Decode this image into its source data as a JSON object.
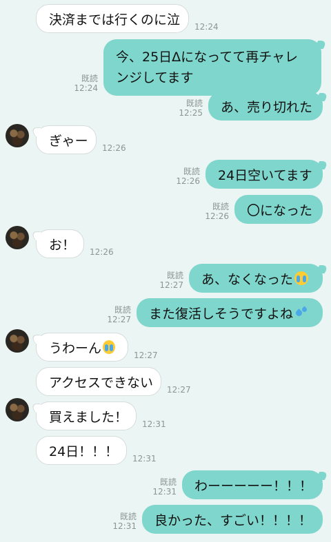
{
  "colors": {
    "background": "#ebf5f3",
    "outgoing_bubble": "#7fd6cc",
    "incoming_bubble": "#ffffff",
    "meta_text": "#8a9693"
  },
  "messages": [
    {
      "dir": "in",
      "text": "決済までは行くのに泣",
      "time": "12:24",
      "avatar": false
    },
    {
      "dir": "out",
      "text": "今、25日Δになってて再チャレンジしてます",
      "time": "12:24",
      "read": "既読"
    },
    {
      "dir": "out",
      "text": "あ、売り切れた",
      "time": "12:25",
      "read": "既読"
    },
    {
      "dir": "in",
      "text": "ぎゃー",
      "time": "12:26",
      "avatar": true
    },
    {
      "dir": "out",
      "text": "24日空いてます",
      "time": "12:26",
      "read": "既読"
    },
    {
      "dir": "out",
      "text": "〇になった",
      "time": "12:26",
      "read": "既読"
    },
    {
      "dir": "in",
      "text": "お！",
      "time": "12:26",
      "avatar": true
    },
    {
      "dir": "out",
      "text": "あ、なくなった",
      "emoji": "loudly-crying-face-icon",
      "time": "12:27",
      "read": "既読"
    },
    {
      "dir": "out",
      "text": "また復活しそうですよね",
      "emoji": "sweat-droplets-icon",
      "time": "12:27",
      "read": "既読"
    },
    {
      "dir": "in",
      "text": "うわーん",
      "emoji": "loudly-crying-face-icon",
      "time": "12:27",
      "avatar": true
    },
    {
      "dir": "in",
      "text": "アクセスできない",
      "time": "12:27",
      "avatar": false
    },
    {
      "dir": "in",
      "text": "買えました！",
      "time": "12:31",
      "avatar": true
    },
    {
      "dir": "in",
      "text": "24日！！！",
      "time": "12:31",
      "avatar": false
    },
    {
      "dir": "out",
      "text": "わーーーーー！！！",
      "time": "12:31",
      "read": "既読"
    },
    {
      "dir": "out",
      "text": "良かった、すごい！！！！",
      "time": "12:31",
      "read": "既読"
    }
  ]
}
